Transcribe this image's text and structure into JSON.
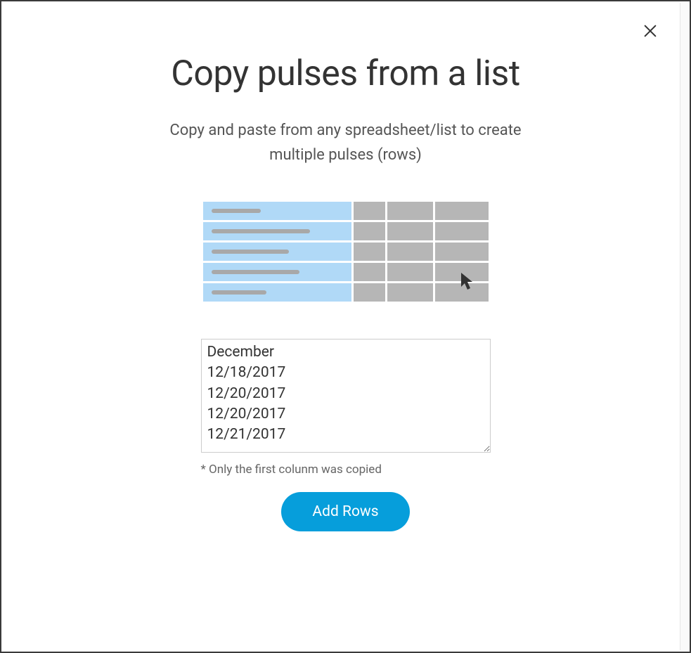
{
  "modal": {
    "title": "Copy pulses from a list",
    "subtitle": "Copy and paste from any spreadsheet/list to create multiple pulses (rows)",
    "textarea_value": "December\n12/18/2017\n12/20/2017\n12/20/2017\n12/21/2017",
    "hint": "* Only the first colunm was copied",
    "add_button_label": "Add Rows"
  }
}
